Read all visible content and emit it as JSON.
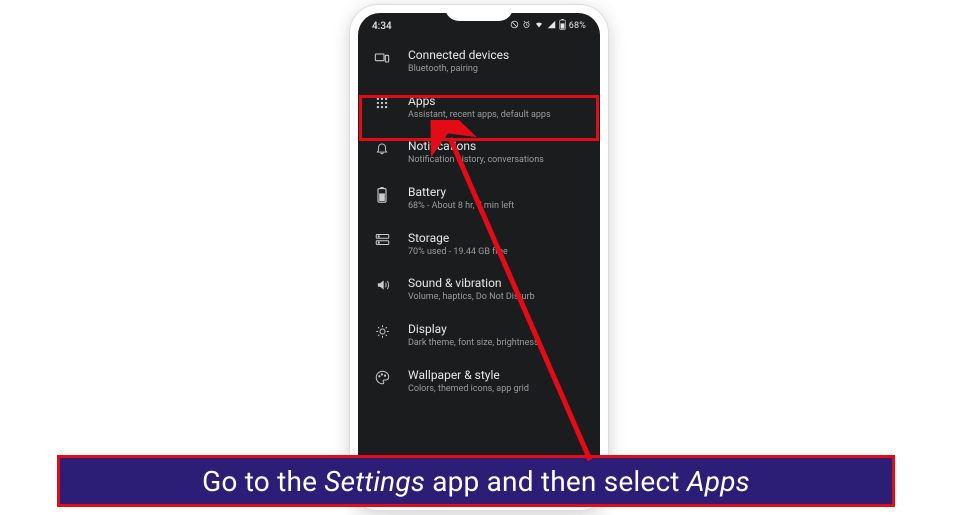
{
  "statusbar": {
    "time": "4:34",
    "battery_text": "68%"
  },
  "settings": [
    {
      "key": "connected",
      "title": "Connected devices",
      "sub": "Bluetooth, pairing"
    },
    {
      "key": "apps",
      "title": "Apps",
      "sub": "Assistant, recent apps, default apps"
    },
    {
      "key": "notifications",
      "title": "Notifications",
      "sub": "Notification history, conversations"
    },
    {
      "key": "battery",
      "title": "Battery",
      "sub": "68% - About 8 hr, 7 min left"
    },
    {
      "key": "storage",
      "title": "Storage",
      "sub": "70% used - 19.44 GB free"
    },
    {
      "key": "sound",
      "title": "Sound & vibration",
      "sub": "Volume, haptics, Do Not Disturb"
    },
    {
      "key": "display",
      "title": "Display",
      "sub": "Dark theme, font size, brightness"
    },
    {
      "key": "wallpaper",
      "title": "Wallpaper & style",
      "sub": "Colors, themed icons, app grid"
    }
  ],
  "instruction": {
    "prefix": "Go to the ",
    "em1": "Settings",
    "mid": " app and then select ",
    "em2": "Apps"
  },
  "highlight": {
    "target": "apps"
  },
  "colors": {
    "accent_red": "#e30b16",
    "banner_bg": "#2c1e76"
  }
}
